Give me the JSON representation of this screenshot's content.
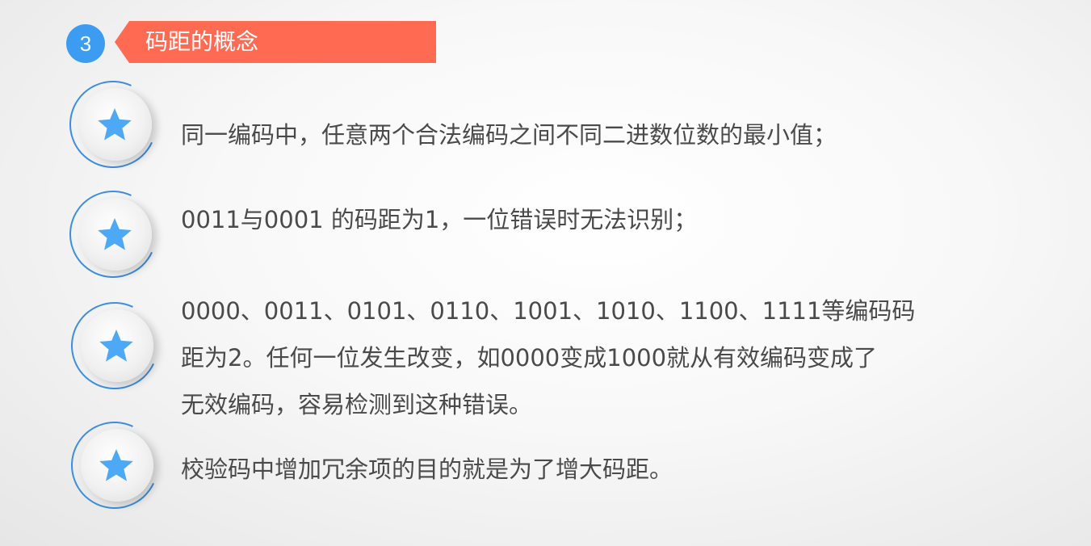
{
  "header": {
    "section_number": "3",
    "title": "码距的概念"
  },
  "icons": {
    "bullet": "star-icon",
    "color": "#4da8f5"
  },
  "colors": {
    "accent_orange": "#ff6b52",
    "accent_blue": "#3b9cf2",
    "text": "#4a4a4a"
  },
  "items": [
    {
      "lines": [
        "同一编码中，任意两个合法编码之间不同二进数位数的最小值；"
      ]
    },
    {
      "lines": [
        "0011与0001 的码距为1，一位错误时无法识别；"
      ]
    },
    {
      "lines": [
        "0000、0011、0101、0110、1001、1010、1100、1111等编码码",
        "距为2。任何一位发生改变，如0000变成1000就从有效编码变成了",
        "无效编码，容易检测到这种错误。"
      ]
    },
    {
      "lines": [
        "校验码中增加冗余项的目的就是为了增大码距。"
      ]
    }
  ]
}
